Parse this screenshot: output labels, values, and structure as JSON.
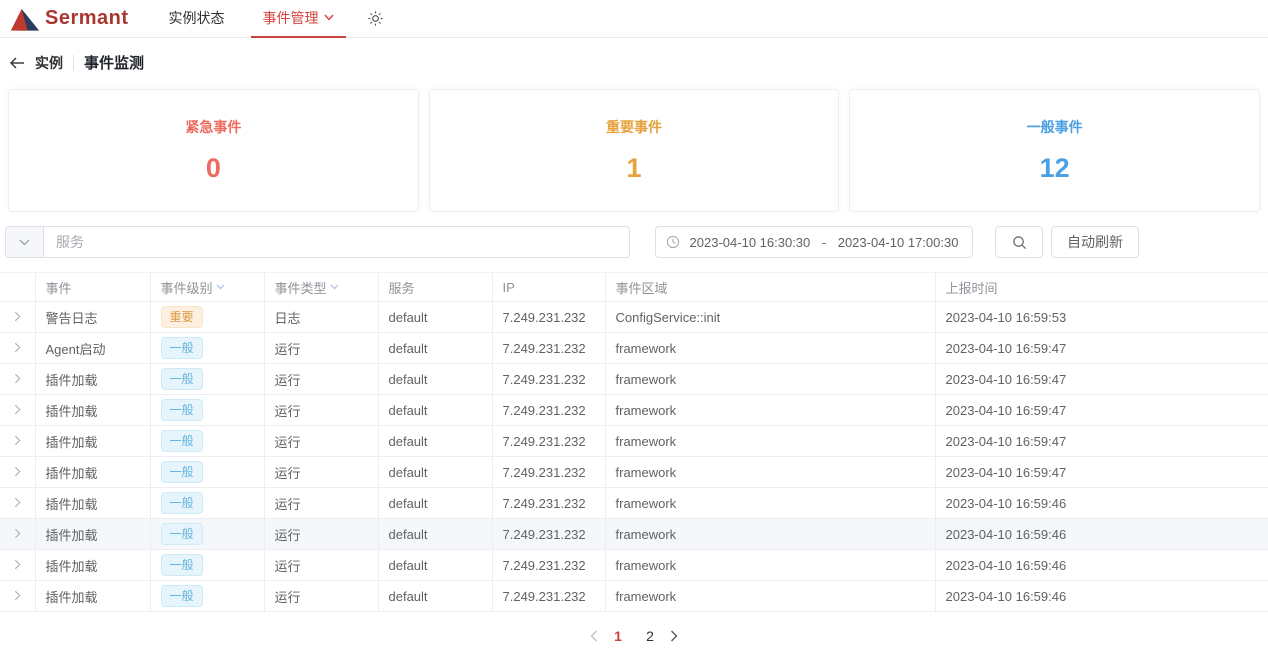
{
  "navbar": {
    "brand": "Sermant",
    "items": [
      {
        "label": "实例状态",
        "active": false
      },
      {
        "label": "事件管理",
        "active": true
      }
    ]
  },
  "breadcrumb": {
    "back_label": "实例",
    "title": "事件监测"
  },
  "cards": [
    {
      "label": "紧急事件",
      "value": "0",
      "color": "#ed6a5e"
    },
    {
      "label": "重要事件",
      "value": "1",
      "color": "#e6a23c"
    },
    {
      "label": "一般事件",
      "value": "12",
      "color": "#4b9fe3"
    }
  ],
  "filters": {
    "service_placeholder": "服务",
    "date_start": "2023-04-10 16:30:30",
    "date_separator": "-",
    "date_end": "2023-04-10 17:00:30",
    "auto_refresh_label": "自动刷新"
  },
  "table": {
    "columns": [
      "事件",
      "事件级别",
      "事件类型",
      "服务",
      "IP",
      "事件区域",
      "上报时间"
    ],
    "sortable_columns": [
      "事件级别",
      "事件类型"
    ],
    "rows": [
      {
        "event": "警告日志",
        "level": "重要",
        "level_type": "warning",
        "type": "日志",
        "service": "default",
        "ip": "7.249.231.232",
        "scope": "ConfigService::init",
        "time": "2023-04-10 16:59:53",
        "hovered": false
      },
      {
        "event": "Agent启动",
        "level": "一般",
        "level_type": "normal",
        "type": "运行",
        "service": "default",
        "ip": "7.249.231.232",
        "scope": "framework",
        "time": "2023-04-10 16:59:47",
        "hovered": false
      },
      {
        "event": "插件加载",
        "level": "一般",
        "level_type": "normal",
        "type": "运行",
        "service": "default",
        "ip": "7.249.231.232",
        "scope": "framework",
        "time": "2023-04-10 16:59:47",
        "hovered": false
      },
      {
        "event": "插件加载",
        "level": "一般",
        "level_type": "normal",
        "type": "运行",
        "service": "default",
        "ip": "7.249.231.232",
        "scope": "framework",
        "time": "2023-04-10 16:59:47",
        "hovered": false
      },
      {
        "event": "插件加载",
        "level": "一般",
        "level_type": "normal",
        "type": "运行",
        "service": "default",
        "ip": "7.249.231.232",
        "scope": "framework",
        "time": "2023-04-10 16:59:47",
        "hovered": false
      },
      {
        "event": "插件加载",
        "level": "一般",
        "level_type": "normal",
        "type": "运行",
        "service": "default",
        "ip": "7.249.231.232",
        "scope": "framework",
        "time": "2023-04-10 16:59:47",
        "hovered": false
      },
      {
        "event": "插件加载",
        "level": "一般",
        "level_type": "normal",
        "type": "运行",
        "service": "default",
        "ip": "7.249.231.232",
        "scope": "framework",
        "time": "2023-04-10 16:59:46",
        "hovered": false
      },
      {
        "event": "插件加载",
        "level": "一般",
        "level_type": "normal",
        "type": "运行",
        "service": "default",
        "ip": "7.249.231.232",
        "scope": "framework",
        "time": "2023-04-10 16:59:46",
        "hovered": true
      },
      {
        "event": "插件加载",
        "level": "一般",
        "level_type": "normal",
        "type": "运行",
        "service": "default",
        "ip": "7.249.231.232",
        "scope": "framework",
        "time": "2023-04-10 16:59:46",
        "hovered": false
      },
      {
        "event": "插件加载",
        "level": "一般",
        "level_type": "normal",
        "type": "运行",
        "service": "default",
        "ip": "7.249.231.232",
        "scope": "framework",
        "time": "2023-04-10 16:59:46",
        "hovered": false
      }
    ]
  },
  "pagination": {
    "pages": [
      "1",
      "2"
    ],
    "current": "1"
  },
  "icons": {
    "brand": "sermant-triangle-logo-icon",
    "nav_dropdown": "chevron-down-icon",
    "theme": "sun-icon",
    "back": "arrow-left-icon",
    "select": "chevron-down-icon",
    "date": "clock-icon",
    "search": "magnifier-icon",
    "sort": "chevron-down-icon",
    "expand": "chevron-right-icon",
    "prev": "chevron-left-icon",
    "next": "chevron-right-icon"
  },
  "colors": {
    "accent_red": "#c8413b",
    "urgent": "#ed6a5e",
    "important": "#e6a23c",
    "normal": "#4b9fe3"
  }
}
